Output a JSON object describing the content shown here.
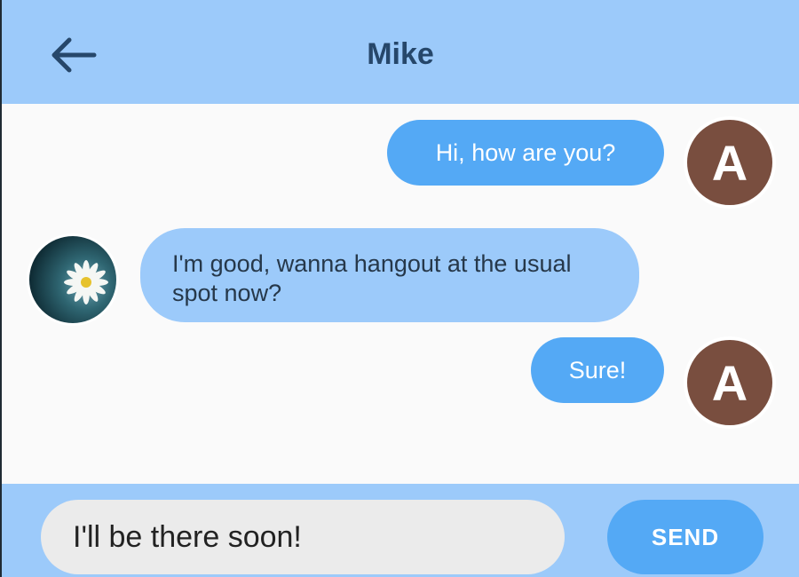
{
  "header": {
    "back_icon": "arrow-left-icon",
    "title": "Mike"
  },
  "messages": [
    {
      "from": "me",
      "text": "Hi, how are you?",
      "avatar_letter": "A"
    },
    {
      "from": "contact",
      "text": "I'm good, wanna hangout at the usual spot now?",
      "avatar": "daisy-photo"
    },
    {
      "from": "me",
      "text": "Sure!",
      "avatar_letter": "A"
    }
  ],
  "composer": {
    "value": "I'll be there soon!",
    "send_label": "SEND"
  },
  "colors": {
    "header_bg": "#9ccafa",
    "title": "#26476a",
    "my_bubble": "#54a9f5",
    "their_bubble": "#9ccafa",
    "avatar_bg": "#794e3f",
    "input_bg": "#ebebeb"
  }
}
